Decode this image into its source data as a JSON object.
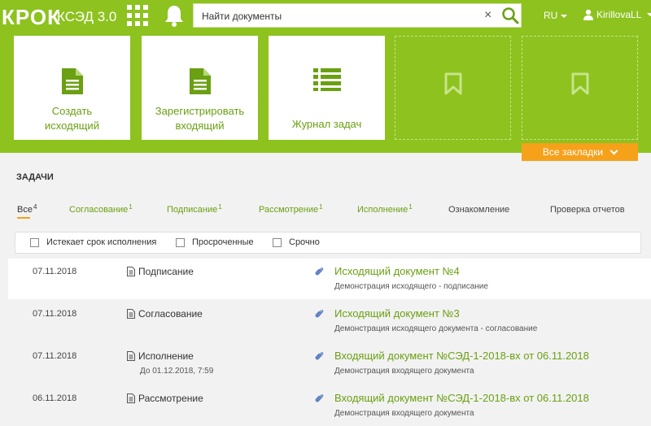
{
  "header": {
    "logo": "КРОК",
    "app_name": "КСЭД 3.0",
    "search_placeholder": "Найти документы",
    "clear_symbol": "×",
    "lang": "RU",
    "user": "KirillovaLL"
  },
  "tiles": [
    {
      "line1": "Создать",
      "line2": "исходящий",
      "icon": "document-icon"
    },
    {
      "line1": "Зарегистрировать",
      "line2": "входящий",
      "icon": "document-icon"
    },
    {
      "line1": "Журнал задач",
      "line2": "",
      "icon": "list-icon"
    }
  ],
  "bookmarks_label": "Все закладки",
  "tasks": {
    "title": "ЗАДАЧИ",
    "tabs": [
      {
        "label": "Все",
        "count": "4"
      },
      {
        "label": "Согласование",
        "count": "1"
      },
      {
        "label": "Подписание",
        "count": "1"
      },
      {
        "label": "Рассмотрение",
        "count": "1"
      },
      {
        "label": "Исполнение",
        "count": "1"
      },
      {
        "label": "Ознакомление",
        "count": ""
      },
      {
        "label": "Проверка отчетов",
        "count": ""
      }
    ],
    "filters": [
      "Истекает срок исполнения",
      "Просроченные",
      "Срочно"
    ],
    "rows": [
      {
        "date": "07.11.2018",
        "type": "Подписание",
        "due": "",
        "title": "Исходящий документ №4",
        "desc": "Демонстрация исходящего - подписание"
      },
      {
        "date": "07.11.2018",
        "type": "Согласование",
        "due": "",
        "title": "Исходящий документ №3",
        "desc": "Демонстрация исходящего документа - согласование"
      },
      {
        "date": "07.11.2018",
        "type": "Исполнение",
        "due": "До 01.12.2018, 7:59",
        "title": "Входящий документ №СЭД-1-2018-вх от 06.11.2018",
        "desc": "Демонстрация входящего документа"
      },
      {
        "date": "06.11.2018",
        "type": "Рассмотрение",
        "due": "",
        "title": "Входящий документ №СЭД-1-2018-вх от 06.11.2018",
        "desc": "Демонстрация входящего документа"
      }
    ]
  },
  "colors": {
    "brand_green": "#8dc21f",
    "link_green": "#6aa012",
    "accent_orange": "#f6a11a"
  }
}
